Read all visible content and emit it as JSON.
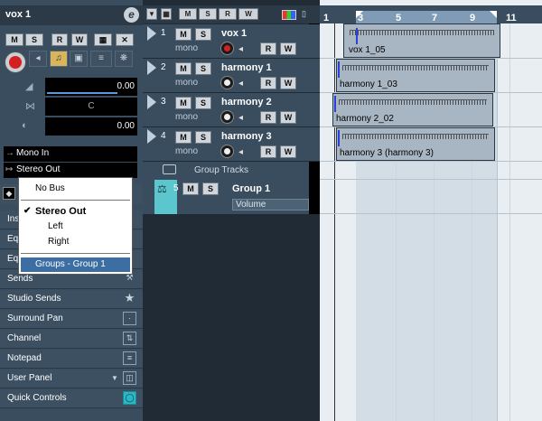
{
  "inspector": {
    "track_name": "vox 1",
    "edit_icon": "e",
    "buttons": {
      "mute": "M",
      "solo": "S",
      "read": "R",
      "write": "W"
    },
    "volume_value": "0.00",
    "pan_value": "C",
    "delay_value": "0.00",
    "input_routing": "Mono In",
    "output_routing": "Stereo Out",
    "sections": [
      {
        "label": "Ins",
        "icon": ""
      },
      {
        "label": "Eq",
        "icon": ""
      },
      {
        "label": "Eq",
        "icon": ""
      },
      {
        "label": "Sends",
        "icon": "sends-icon"
      },
      {
        "label": "Studio Sends",
        "icon": "star-icon"
      },
      {
        "label": "Surround Pan",
        "icon": "dot-icon"
      },
      {
        "label": "Channel",
        "icon": "fader-icon"
      },
      {
        "label": "Notepad",
        "icon": "notepad-icon"
      },
      {
        "label": "User Panel",
        "icon": "panel-icon"
      },
      {
        "label": "Quick Controls",
        "icon": "knob-icon"
      }
    ]
  },
  "dropdown": {
    "items": [
      "No Bus",
      "Stereo Out",
      "Left",
      "Right",
      "Groups - Group 1"
    ],
    "checked": "Stereo Out",
    "highlighted": "Groups - Group 1"
  },
  "tracks": [
    {
      "num": "1",
      "name": "vox 1",
      "channel": "mono",
      "rec_armed": true
    },
    {
      "num": "2",
      "name": "harmony 1",
      "channel": "mono",
      "rec_armed": false
    },
    {
      "num": "3",
      "name": "harmony 2",
      "channel": "mono",
      "rec_armed": false
    },
    {
      "num": "4",
      "name": "harmony 3",
      "channel": "mono",
      "rec_armed": false
    }
  ],
  "group_folder_label": "Group Tracks",
  "group_track": {
    "num": "5",
    "name": "Group 1",
    "automation": "Volume"
  },
  "ruler": {
    "bars": [
      "1",
      "3",
      "5",
      "7",
      "9",
      "11"
    ]
  },
  "parts": [
    {
      "name": "vox 1_05"
    },
    {
      "name": "harmony 1_03"
    },
    {
      "name": "harmony 2_02"
    },
    {
      "name": "harmony 3 (harmony 3)"
    }
  ]
}
